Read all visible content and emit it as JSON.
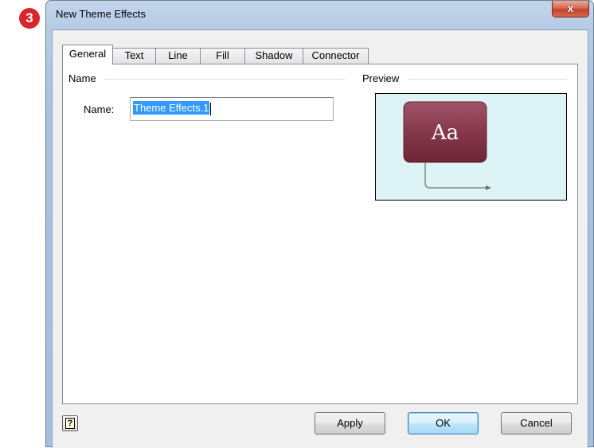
{
  "step_badge": "3",
  "window": {
    "title": "New Theme Effects",
    "close_label": "x"
  },
  "tabs": [
    {
      "label": "General",
      "active": true
    },
    {
      "label": "Text"
    },
    {
      "label": "Line"
    },
    {
      "label": "Fill"
    },
    {
      "label": "Shadow"
    },
    {
      "label": "Connector"
    }
  ],
  "general": {
    "name_group_label": "Name",
    "name_field_label": "Name:",
    "name_value": "Theme Effects.1",
    "preview_group_label": "Preview",
    "preview_sample_text": "Aa"
  },
  "buttons": {
    "help_label": "?",
    "apply_label": "Apply",
    "ok_label": "OK",
    "cancel_label": "Cancel"
  },
  "colors": {
    "badge": "#d9262b",
    "preview_background": "#def3f5",
    "preview_shape": "#8c3a4c",
    "selection": "#3399ff"
  }
}
